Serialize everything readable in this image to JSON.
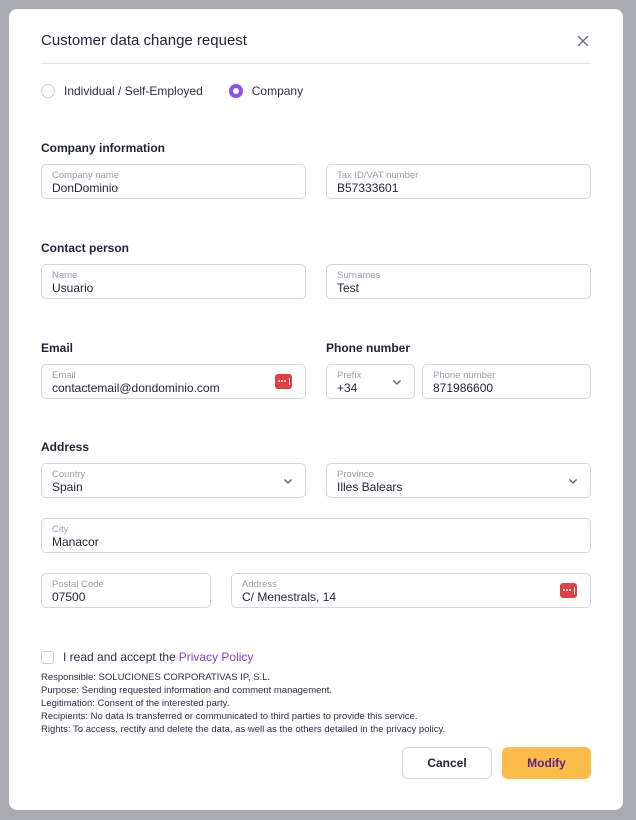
{
  "dialog": {
    "title": "Customer data change request",
    "close_icon": "close-icon"
  },
  "customer_type": {
    "options": [
      {
        "label": "Individual / Self-Employed",
        "checked": false
      },
      {
        "label": "Company",
        "checked": true
      }
    ],
    "accent_color": "#8b4ff0"
  },
  "sections": {
    "company_information": "Company information",
    "contact_person": "Contact person",
    "email": "Email",
    "phone_number": "Phone number",
    "address": "Address"
  },
  "fields": {
    "company_name": {
      "label": "Company name",
      "value": "DonDominio"
    },
    "tax_id": {
      "label": "Tax ID/VAT number",
      "value": "B57333601"
    },
    "name": {
      "label": "Name",
      "value": "Usuario"
    },
    "surnames": {
      "label": "Surnames",
      "value": "Test"
    },
    "email": {
      "label": "Email",
      "value": "contactemail@dondominio.com"
    },
    "prefix": {
      "label": "Prefix",
      "value": "+34"
    },
    "phone": {
      "label": "Phone number",
      "value": "871986600"
    },
    "country": {
      "label": "Country",
      "value": "Spain"
    },
    "province": {
      "label": "Province",
      "value": "Illes Balears"
    },
    "city": {
      "label": "City",
      "value": "Manacor"
    },
    "postal_code": {
      "label": "Postal Code",
      "value": "07500"
    },
    "address": {
      "label": "Address",
      "value": "C/ Menestrals, 14"
    }
  },
  "consent": {
    "text": "I read and accept the",
    "link": "Privacy Policy",
    "checked": false,
    "link_color": "#8b3fd9"
  },
  "legal": [
    "Responsible: SOLUCIONES CORPORATIVAS IP, S.L.",
    "Purpose: Sending requested information and comment management.",
    "Legitimation: Consent of the interested party.",
    "Recipients: No data is transferred or communicated to third parties to provide this service.",
    "Rights: To access, rectify and delete the data, as well as the others detailed in the privacy policy."
  ],
  "buttons": {
    "cancel": "Cancel",
    "modify": "Modify",
    "modify_color": "#fcbc4a"
  }
}
